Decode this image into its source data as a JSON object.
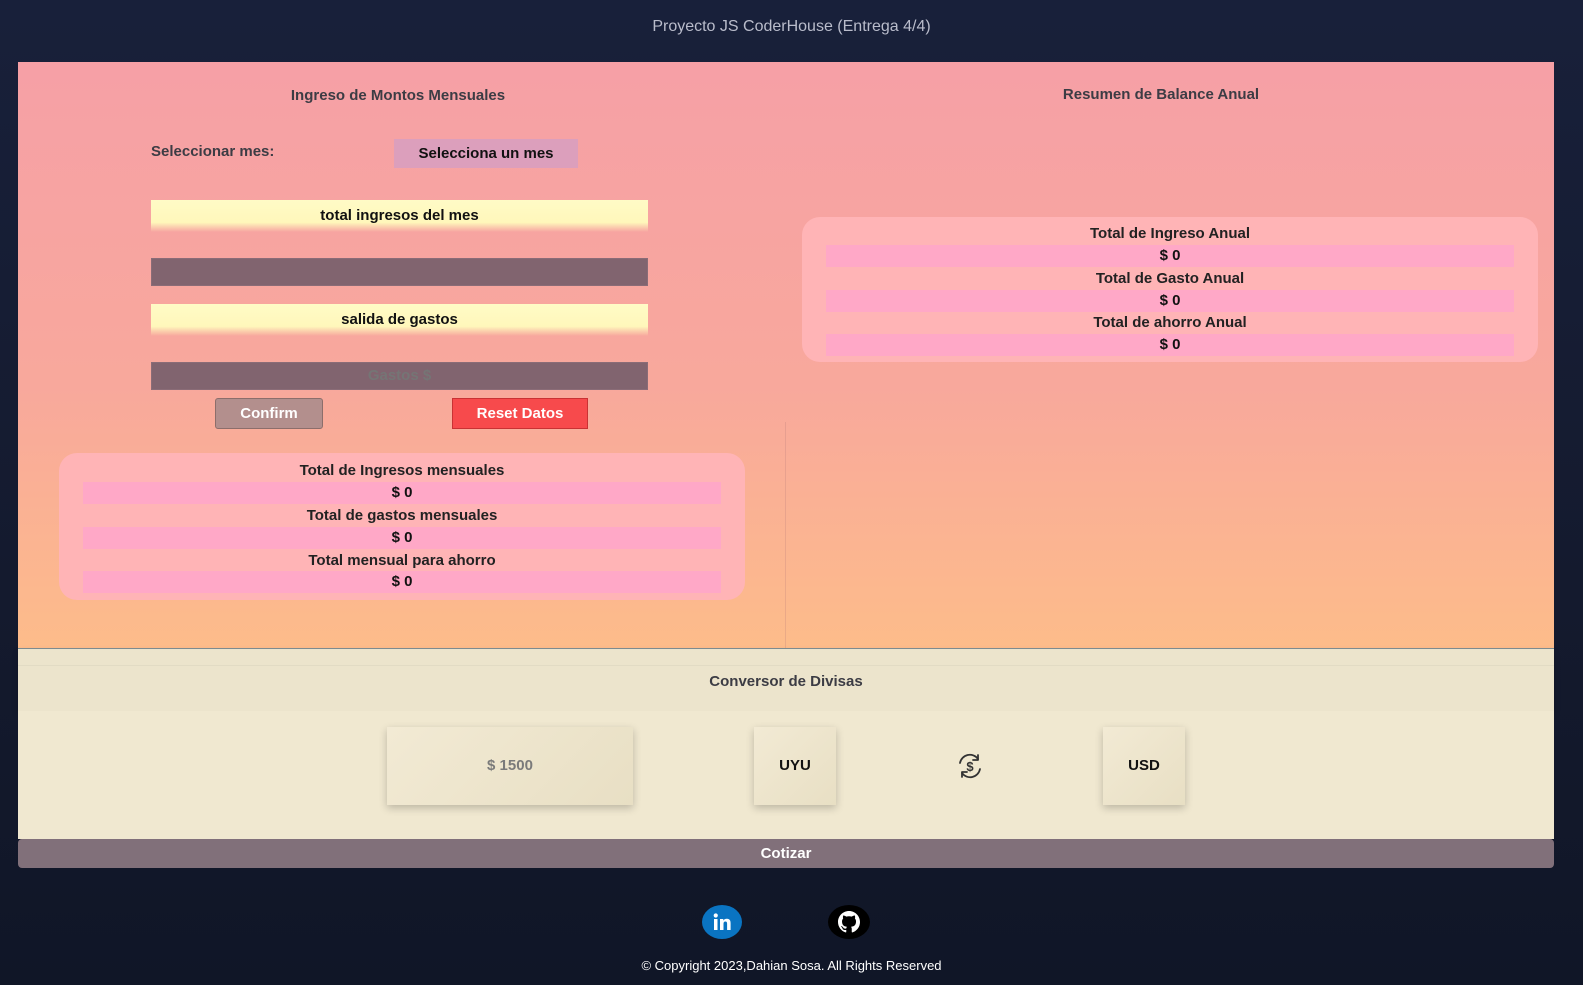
{
  "page": {
    "title": "Proyecto JS CoderHouse (Entrega 4/4)"
  },
  "monthly": {
    "heading": "Ingreso de Montos Mensuales",
    "month_label": "Seleccionar mes:",
    "month_select_value": "Selecciona un mes",
    "income_bar_label": "total ingresos del mes",
    "income_input_placeholder": "",
    "expense_bar_label": "salida de gastos",
    "expense_input_placeholder": "Gastos $",
    "confirm_label": "Confirm",
    "reset_label": "Reset Datos",
    "summary": [
      {
        "label": "Total de Ingresos mensuales",
        "value": "$ 0"
      },
      {
        "label": "Total de gastos mensuales",
        "value": "$ 0"
      },
      {
        "label": "Total mensual para ahorro",
        "value": "$ 0"
      }
    ]
  },
  "annual": {
    "heading": "Resumen de Balance Anual",
    "summary": [
      {
        "label": "Total de Ingreso Anual",
        "value": "$ 0"
      },
      {
        "label": "Total de Gasto Anual",
        "value": "$ 0"
      },
      {
        "label": "Total de ahorro Anual",
        "value": "$ 0"
      }
    ]
  },
  "converter": {
    "heading": "Conversor de Divisas",
    "amount_placeholder": "$ 1500",
    "from_currency": "UYU",
    "to_currency": "USD",
    "swap_icon": "currency-exchange-icon",
    "quote_label": "Cotizar"
  },
  "footer": {
    "social": [
      {
        "name": "linkedin-icon",
        "color": "#0a74c2"
      },
      {
        "name": "github-icon",
        "color": "#000000"
      }
    ],
    "copyright": "© Copyright 2023,Dahian Sosa. All Rights Reserved"
  }
}
